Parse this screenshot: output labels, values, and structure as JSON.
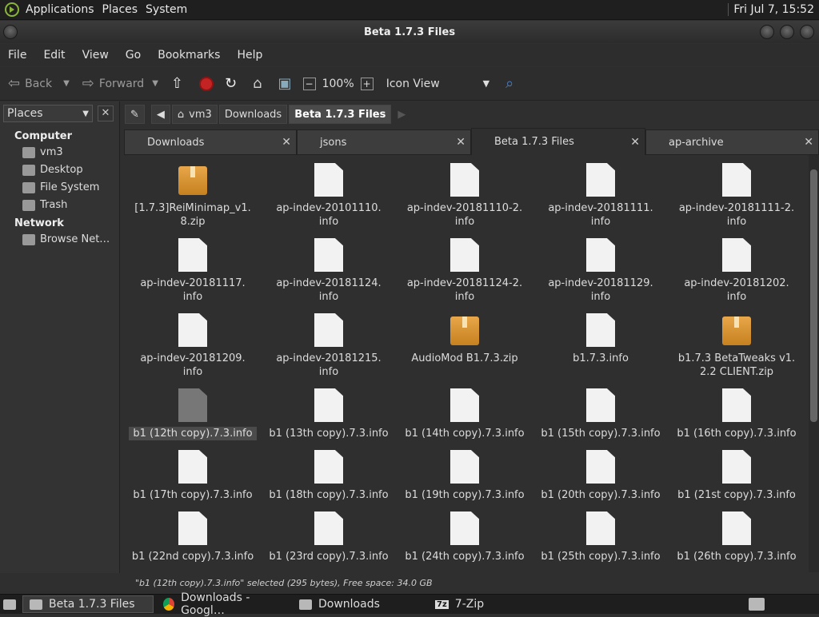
{
  "topbar": {
    "menus": [
      "Applications",
      "Places",
      "System"
    ],
    "clock": "Fri Jul  7, 15:52"
  },
  "window": {
    "title": "Beta 1.7.3 Files"
  },
  "menubar": [
    "File",
    "Edit",
    "View",
    "Go",
    "Bookmarks",
    "Help"
  ],
  "toolbar": {
    "back": "Back",
    "forward": "Forward",
    "zoom": "100%",
    "view": "Icon View"
  },
  "places": {
    "label": "Places",
    "computer": "Computer",
    "network": "Network",
    "items": [
      "vm3",
      "Desktop",
      "File System",
      "Trash"
    ],
    "net_items": [
      "Browse Net…"
    ]
  },
  "path": [
    "vm3",
    "Downloads",
    "Beta 1.7.3 Files"
  ],
  "tabs": [
    "Downloads",
    "jsons",
    "Beta 1.7.3 Files",
    "ap-archive"
  ],
  "files": [
    {
      "name": "[1.7.3]ReiMinimap_v1.\n8.zip",
      "type": "zip"
    },
    {
      "name": "ap-indev-20101110.\ninfo",
      "type": "doc"
    },
    {
      "name": "ap-indev-20181110-2.\ninfo",
      "type": "doc"
    },
    {
      "name": "ap-indev-20181111.\ninfo",
      "type": "doc"
    },
    {
      "name": "ap-indev-20181111-2.\ninfo",
      "type": "doc"
    },
    {
      "name": "ap-indev-20181117.\ninfo",
      "type": "doc"
    },
    {
      "name": "ap-indev-20181124.\ninfo",
      "type": "doc"
    },
    {
      "name": "ap-indev-20181124-2.\ninfo",
      "type": "doc"
    },
    {
      "name": "ap-indev-20181129.\ninfo",
      "type": "doc"
    },
    {
      "name": "ap-indev-20181202.\ninfo",
      "type": "doc"
    },
    {
      "name": "ap-indev-20181209.\ninfo",
      "type": "doc"
    },
    {
      "name": "ap-indev-20181215.\ninfo",
      "type": "doc"
    },
    {
      "name": "AudioMod B1.7.3.zip",
      "type": "zip"
    },
    {
      "name": "b1.7.3.info",
      "type": "doc"
    },
    {
      "name": "b1.7.3 BetaTweaks v1.\n2.2 CLIENT.zip",
      "type": "zip"
    },
    {
      "name": "b1 (12th copy).7.3.info",
      "type": "doc",
      "selected": true
    },
    {
      "name": "b1 (13th copy).7.3.info",
      "type": "doc"
    },
    {
      "name": "b1 (14th copy).7.3.info",
      "type": "doc"
    },
    {
      "name": "b1 (15th copy).7.3.info",
      "type": "doc"
    },
    {
      "name": "b1 (16th copy).7.3.info",
      "type": "doc"
    },
    {
      "name": "b1 (17th copy).7.3.info",
      "type": "doc"
    },
    {
      "name": "b1 (18th copy).7.3.info",
      "type": "doc"
    },
    {
      "name": "b1 (19th copy).7.3.info",
      "type": "doc"
    },
    {
      "name": "b1 (20th copy).7.3.info",
      "type": "doc"
    },
    {
      "name": "b1 (21st copy).7.3.info",
      "type": "doc"
    },
    {
      "name": "b1 (22nd copy).7.3.info",
      "type": "doc"
    },
    {
      "name": "b1 (23rd copy).7.3.info",
      "type": "doc"
    },
    {
      "name": "b1 (24th copy).7.3.info",
      "type": "doc"
    },
    {
      "name": "b1 (25th copy).7.3.info",
      "type": "doc"
    },
    {
      "name": "b1 (26th copy).7.3.info",
      "type": "doc"
    }
  ],
  "status": "\"b1 (12th copy).7.3.info\" selected (295 bytes), Free space: 34.0 GB",
  "taskbar": [
    "Beta 1.7.3 Files",
    "Downloads - Googl…",
    "Downloads",
    "7-Zip"
  ]
}
